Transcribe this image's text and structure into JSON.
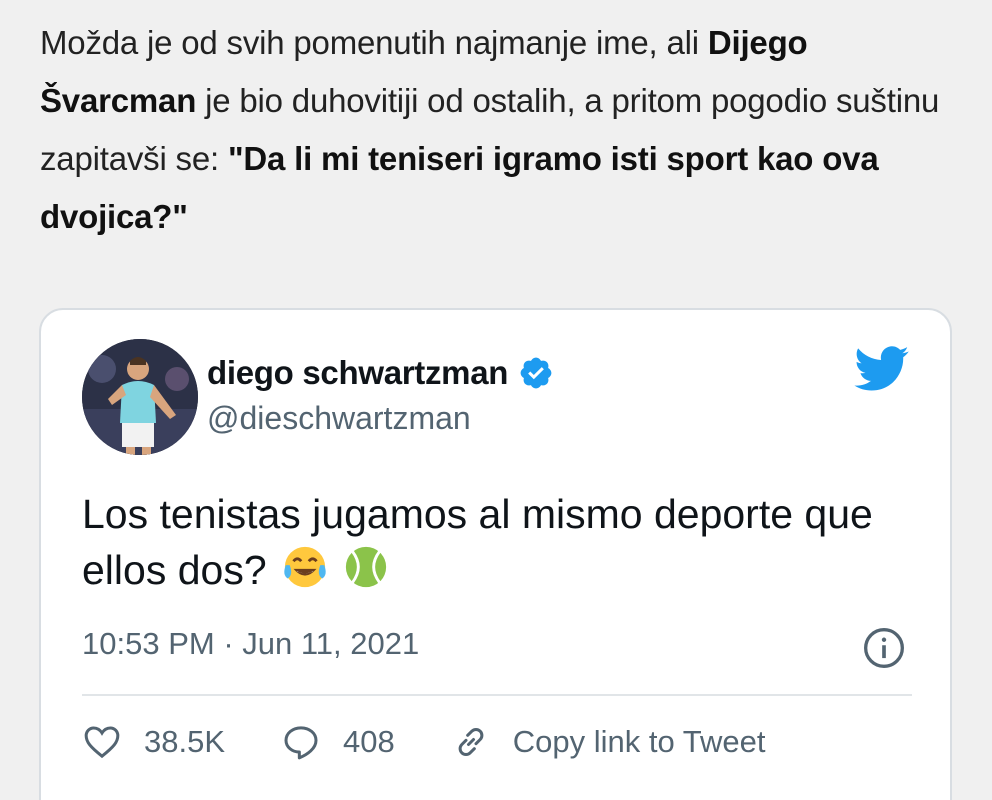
{
  "article": {
    "part1": "Možda je od svih pomenutih najmanje ime, ali ",
    "name_bold": "Dijego Švarcman",
    "part2": " je bio duhovitiji od ostalih, a pritom pogodio suštinu zapitavši se: ",
    "quote_bold": "\"Da li mi teniseri igramo isti sport kao ova dvojica?\""
  },
  "tweet": {
    "author_name": "diego schwartzman",
    "author_handle": "@dieschwartzman",
    "text": "Los tenistas jugamos al mismo deporte que ellos dos?",
    "emojis": [
      "tears-of-joy-emoji",
      "tennis-ball-emoji"
    ],
    "time": "10:53 PM",
    "separator": " · ",
    "date": "Jun 11, 2021",
    "likes": "38.5K",
    "replies": "408",
    "copy_link_label": "Copy link to Tweet",
    "colors": {
      "twitter_blue": "#1d9bf0",
      "muted": "#536471"
    }
  }
}
